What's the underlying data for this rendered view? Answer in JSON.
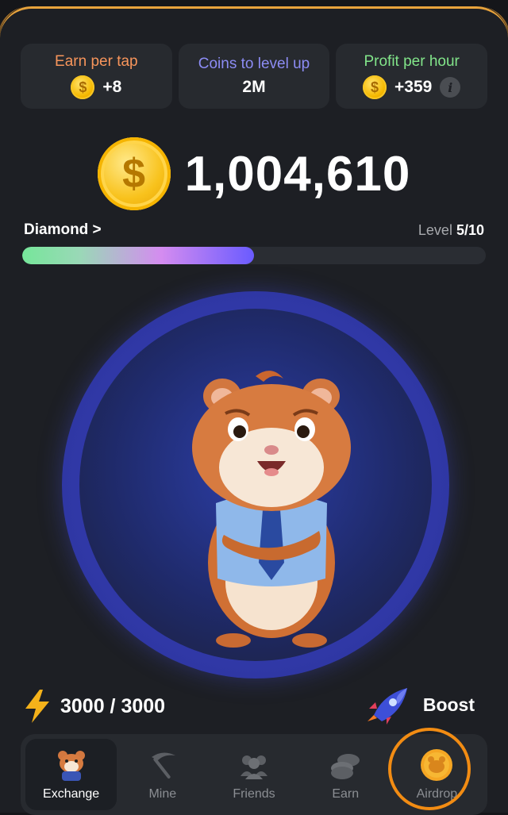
{
  "stats": [
    {
      "label": "Earn per tap",
      "value": "+8",
      "label_color": "#f7955b",
      "has_coin": true,
      "has_info": false
    },
    {
      "label": "Coins to level up",
      "value": "2M",
      "label_color": "#8c8cf4",
      "has_coin": false,
      "has_info": false
    },
    {
      "label": "Profit per hour",
      "value": "+359",
      "label_color": "#82e58a",
      "has_coin": true,
      "has_info": true
    }
  ],
  "balance": "1,004,610",
  "level": {
    "name": "Diamond >",
    "label": "Level ",
    "value": "5/10",
    "progress": 0.5
  },
  "energy": "3000 / 3000",
  "boost": "Boost",
  "nav": [
    {
      "label": "Exchange",
      "icon": "hamster-icon",
      "active": true
    },
    {
      "label": "Mine",
      "icon": "pickaxe-icon",
      "active": false
    },
    {
      "label": "Friends",
      "icon": "friends-icon",
      "active": false
    },
    {
      "label": "Earn",
      "icon": "coins-icon",
      "active": false
    },
    {
      "label": "Airdrop",
      "icon": "airdrop-coin-icon",
      "active": false,
      "highlighted": true
    }
  ],
  "colors": {
    "accent": "#f7c623",
    "highlight": "#f28c13",
    "panel": "#272a2f",
    "background": "#1d1f24"
  }
}
